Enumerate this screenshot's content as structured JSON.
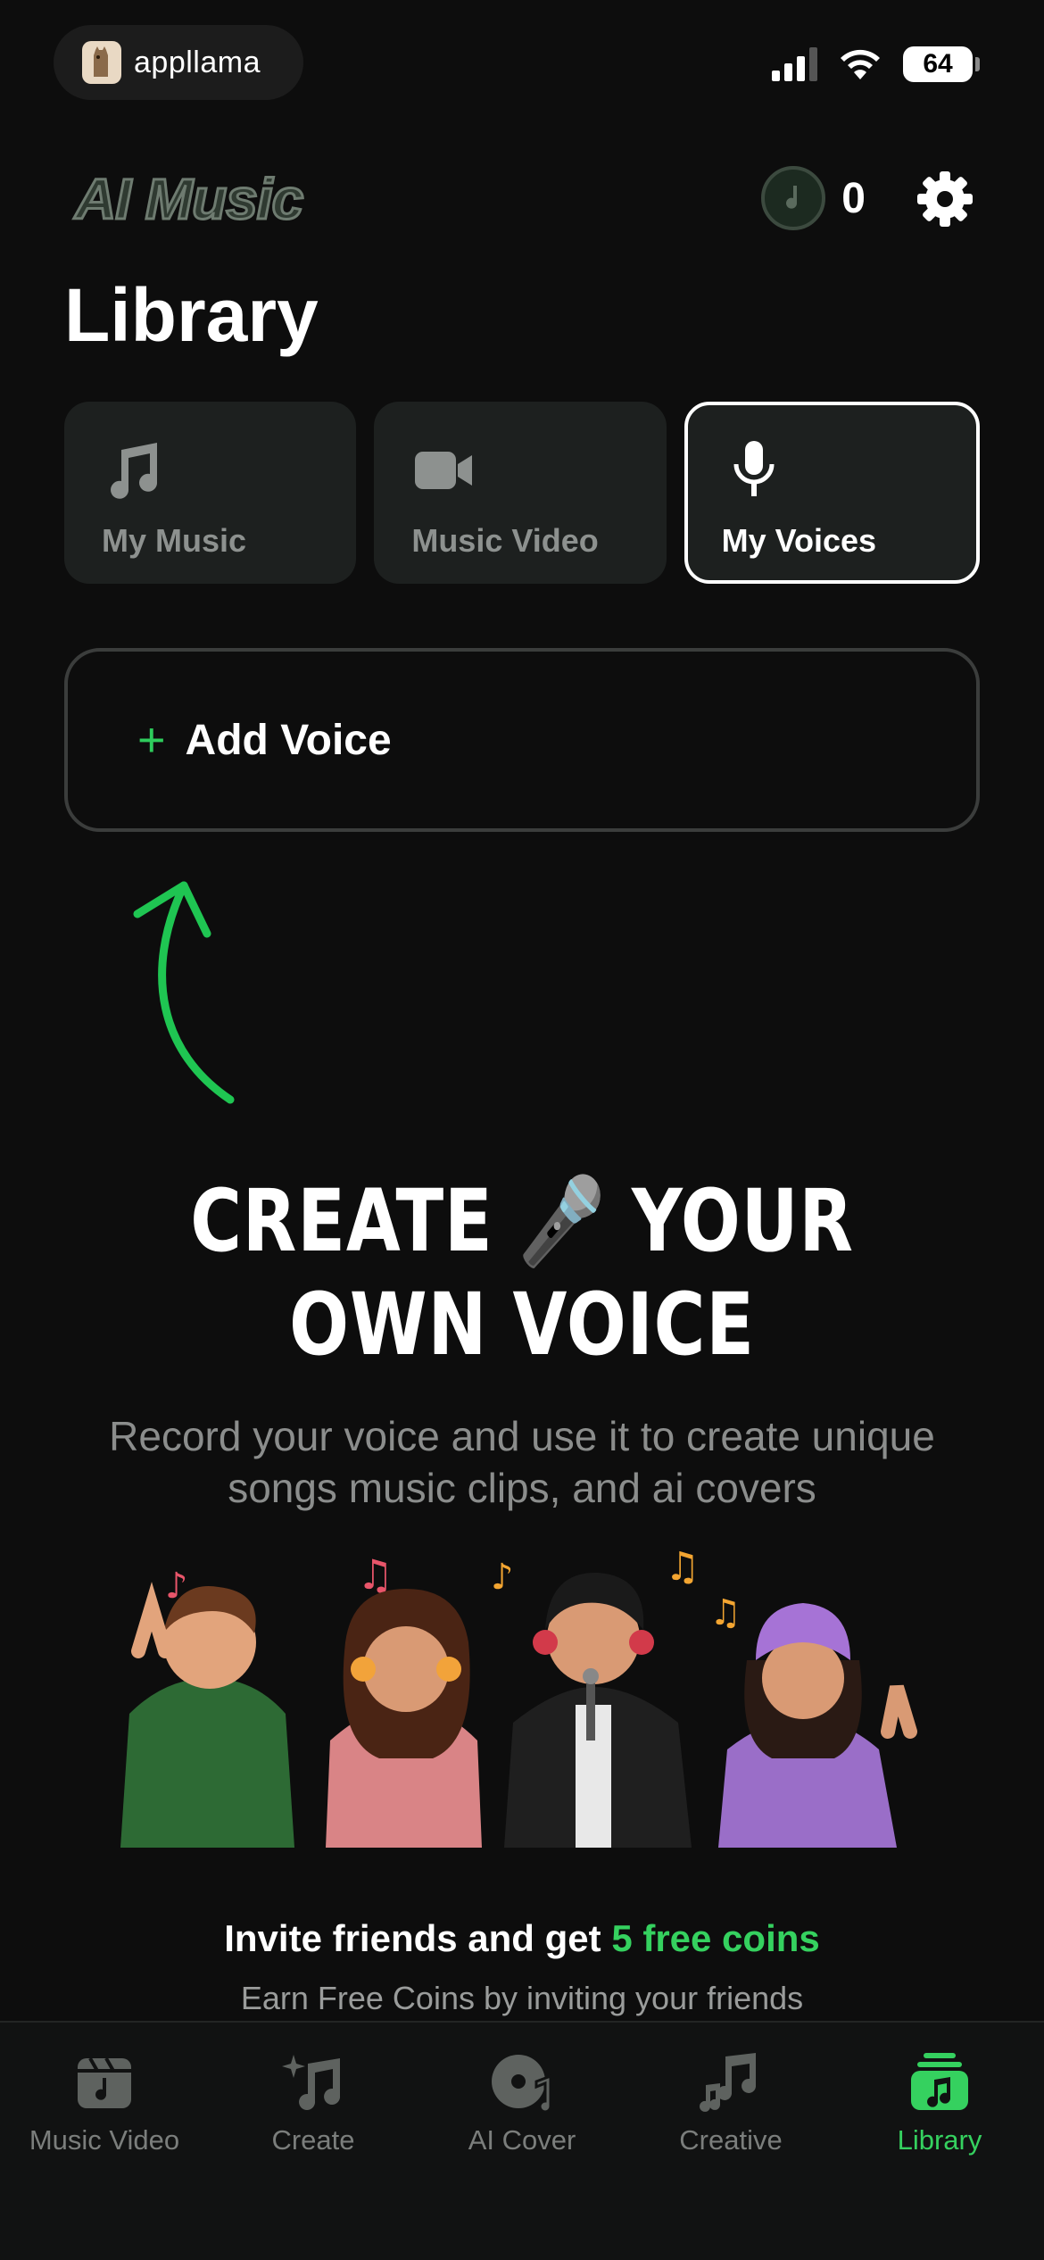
{
  "status_bar": {
    "carrier": "appllama",
    "battery": "64"
  },
  "header": {
    "logo_text": "AI Music",
    "coins": "0"
  },
  "page_title": "Library",
  "tabs": [
    {
      "label": "My Music",
      "icon": "music-note-icon",
      "active": false
    },
    {
      "label": "Music Video",
      "icon": "video-camera-icon",
      "active": false
    },
    {
      "label": "My Voices",
      "icon": "microphone-icon",
      "active": true
    }
  ],
  "add_voice": {
    "plus": "+",
    "label": "Add Voice"
  },
  "hero": {
    "title_line1": "CREATE 🎤 YOUR",
    "title_line2": "OWN VOICE",
    "subtitle": "Record your voice and use it to create unique songs music clips, and ai covers"
  },
  "invite": {
    "title_prefix": "Invite friends and get",
    "title_highlight": "5 free coins",
    "subtitle": "Earn Free Coins by inviting your friends"
  },
  "bottom_nav": [
    {
      "label": "Music Video",
      "icon": "music-video-icon",
      "active": false
    },
    {
      "label": "Create",
      "icon": "sparkle-music-icon",
      "active": false
    },
    {
      "label": "AI Cover",
      "icon": "vinyl-icon",
      "active": false
    },
    {
      "label": "Creative",
      "icon": "creative-notes-icon",
      "active": false
    },
    {
      "label": "Library",
      "icon": "library-icon",
      "active": true
    }
  ],
  "colors": {
    "accent": "#35d15f",
    "background": "#0d0d0d",
    "card": "#1d201f"
  }
}
